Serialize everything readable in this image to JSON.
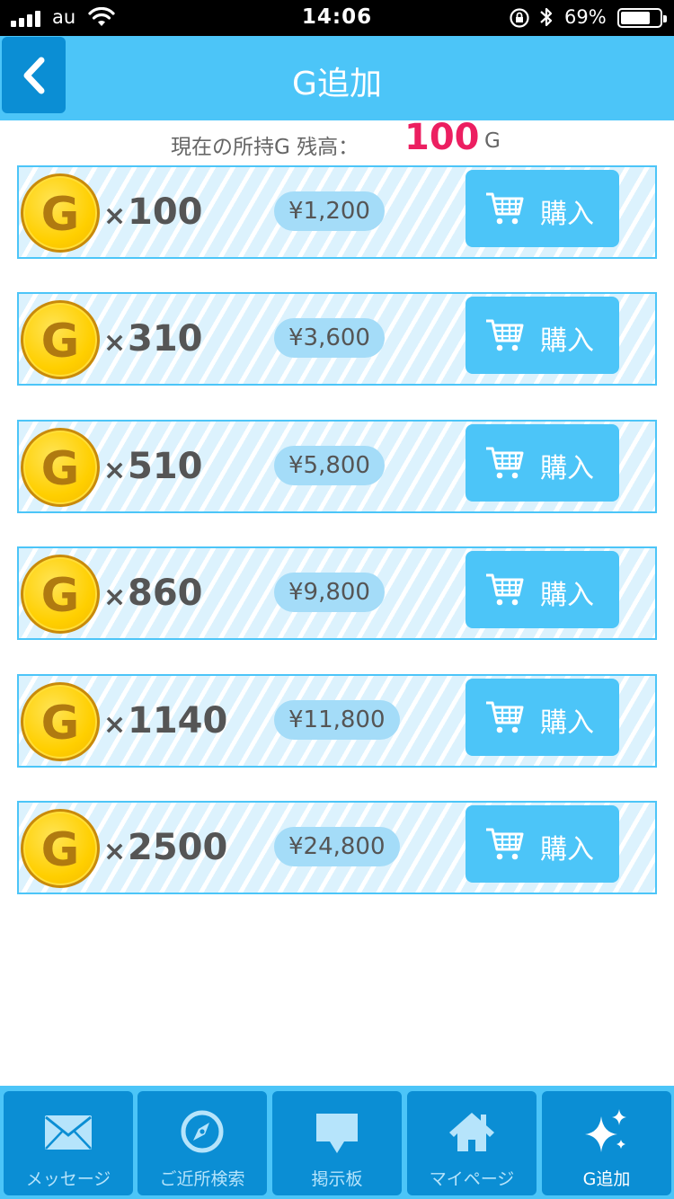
{
  "status_bar": {
    "carrier": "au",
    "time": "14:06",
    "battery_percent": "69%"
  },
  "header": {
    "title": "G追加"
  },
  "balance": {
    "label": "現在の所持G 残高：",
    "value": "100",
    "unit": "G"
  },
  "packages": [
    {
      "coin_letter": "G",
      "times": "×",
      "amount": "100",
      "price": "¥1,200",
      "buy_label": "購入"
    },
    {
      "coin_letter": "G",
      "times": "×",
      "amount": "310",
      "price": "¥3,600",
      "buy_label": "購入"
    },
    {
      "coin_letter": "G",
      "times": "×",
      "amount": "510",
      "price": "¥5,800",
      "buy_label": "購入"
    },
    {
      "coin_letter": "G",
      "times": "×",
      "amount": "860",
      "price": "¥9,800",
      "buy_label": "購入"
    },
    {
      "coin_letter": "G",
      "times": "×",
      "amount": "1140",
      "price": "¥11,800",
      "buy_label": "購入"
    },
    {
      "coin_letter": "G",
      "times": "×",
      "amount": "2500",
      "price": "¥24,800",
      "buy_label": "購入"
    }
  ],
  "tabs": [
    {
      "label": "メッセージ",
      "icon": "envelope-icon"
    },
    {
      "label": "ご近所検索",
      "icon": "compass-icon"
    },
    {
      "label": "掲示板",
      "icon": "speech-bubble-icon"
    },
    {
      "label": "マイページ",
      "icon": "home-icon"
    },
    {
      "label": "G追加",
      "icon": "sparkle-icon",
      "active": true
    }
  ],
  "colors": {
    "accent": "#4cc5f8",
    "dark_accent": "#0b8ed4",
    "balance_value": "#ec1f61",
    "coin": "#ffcf00"
  }
}
